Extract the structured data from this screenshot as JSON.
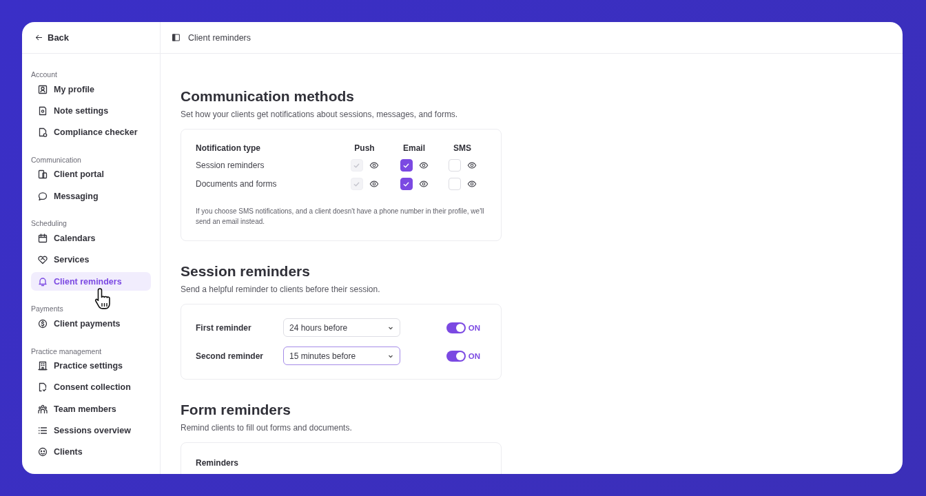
{
  "back": "Back",
  "breadcrumb": "Client reminders",
  "sidebar": [
    {
      "title": "Account",
      "items": [
        {
          "label": "My profile",
          "selected": false
        },
        {
          "label": "Note settings",
          "selected": false
        },
        {
          "label": "Compliance checker",
          "selected": false
        }
      ]
    },
    {
      "title": "Communication",
      "items": [
        {
          "label": "Client portal",
          "selected": false
        },
        {
          "label": "Messaging",
          "selected": false
        }
      ]
    },
    {
      "title": "Scheduling",
      "items": [
        {
          "label": "Calendars",
          "selected": false
        },
        {
          "label": "Services",
          "selected": false
        },
        {
          "label": "Client reminders",
          "selected": true
        }
      ]
    },
    {
      "title": "Payments",
      "items": [
        {
          "label": "Client payments",
          "selected": false
        }
      ]
    },
    {
      "title": "Practice management",
      "items": [
        {
          "label": "Practice settings",
          "selected": false
        },
        {
          "label": "Consent collection",
          "selected": false
        },
        {
          "label": "Team members",
          "selected": false
        },
        {
          "label": "Sessions overview",
          "selected": false
        },
        {
          "label": "Clients",
          "selected": false
        }
      ]
    }
  ],
  "communication": {
    "title": "Communication methods",
    "description": "Set how your clients get notifications about sessions, messages, and forms.",
    "columns": [
      "Notification type",
      "Push",
      "Email",
      "SMS"
    ],
    "rows": [
      {
        "label": "Session reminders",
        "cells": [
          {
            "checked": true,
            "disabled": true
          },
          {
            "checked": true,
            "disabled": false
          },
          {
            "checked": false,
            "disabled": false
          }
        ]
      },
      {
        "label": "Documents and forms",
        "cells": [
          {
            "checked": true,
            "disabled": true
          },
          {
            "checked": true,
            "disabled": false
          },
          {
            "checked": false,
            "disabled": false
          }
        ]
      }
    ],
    "note": "If you choose SMS notifications, and a client doesn't have a phone number in their profile, we'll send an email instead."
  },
  "session": {
    "title": "Session reminders",
    "description": "Send a helpful reminder to clients before their session.",
    "reminders": [
      {
        "label": "First reminder",
        "value": "24 hours before",
        "focused": false,
        "on": true,
        "state": "ON"
      },
      {
        "label": "Second reminder",
        "value": "15 minutes before",
        "focused": true,
        "on": true,
        "state": "ON"
      }
    ]
  },
  "forms": {
    "title": "Form reminders",
    "description": "Remind clients to fill out forms and documents.",
    "heading": "Reminders"
  }
}
